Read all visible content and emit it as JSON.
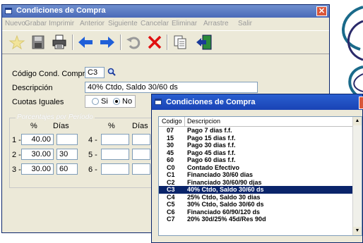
{
  "main_window": {
    "title": "Condiciones de Compra",
    "menu": [
      "Nuevo",
      "Grabar",
      "Imprimir",
      "Anterior",
      "Siguiente",
      "Cancelar",
      "Eliminar",
      "Arrastre",
      "Salir"
    ],
    "toolbar_icons": [
      "new-star-icon",
      "save-disk-icon",
      "print-icon",
      "back-arrow-icon",
      "forward-arrow-icon",
      "undo-icon",
      "delete-x-icon",
      "copy-icon",
      "exit-door-icon"
    ]
  },
  "form": {
    "codigo_label": "Código Cond. Compra",
    "codigo_value": "C3",
    "descripcion_label": "Descripción",
    "descripcion_value": "40% Ctdo, Saldo 30/60 ds",
    "cuotas_label": "Cuotas Iguales",
    "opt_si": "Si",
    "opt_no": "No",
    "cuotas_selected": "No",
    "group_title": "Porcentajes por Período",
    "col_pct": "%",
    "col_dias": "Días",
    "rows": [
      {
        "label": "1 -",
        "pct": "40.00",
        "dias": ""
      },
      {
        "label": "2 -",
        "pct": "30.00",
        "dias": "30"
      },
      {
        "label": "3 -",
        "pct": "30.00",
        "dias": "60"
      }
    ],
    "rows_right": [
      {
        "label": "4 -",
        "pct": "",
        "dias": ""
      },
      {
        "label": "5 -",
        "pct": "",
        "dias": ""
      },
      {
        "label": "6 -",
        "pct": "",
        "dias": ""
      }
    ]
  },
  "popup": {
    "title": "Condiciones de Compra",
    "headers": {
      "codigo": "Codigo",
      "descripcion": "Descripcion"
    },
    "items": [
      {
        "codigo": "07",
        "descripcion": "Pago 7 dias f.f."
      },
      {
        "codigo": "15",
        "descripcion": "Pago 15 dias f.f."
      },
      {
        "codigo": "30",
        "descripcion": "Pago 30 dias f.f."
      },
      {
        "codigo": "45",
        "descripcion": "Pago 45 dias f.f."
      },
      {
        "codigo": "60",
        "descripcion": "Pago 60 dias f.f."
      },
      {
        "codigo": "C0",
        "descripcion": "Contado Efectivo"
      },
      {
        "codigo": "C1",
        "descripcion": "Financiado 30/60 dias"
      },
      {
        "codigo": "C2",
        "descripcion": "Financiado 30/60/90 djas"
      },
      {
        "codigo": "C3",
        "descripcion": "40% Ctdo, Saldo 30/60 ds"
      },
      {
        "codigo": "C4",
        "descripcion": "25% Ctdo, Saldo 30 dias"
      },
      {
        "codigo": "C5",
        "descripcion": "30% Ctdo, Saldo 30/60 ds"
      },
      {
        "codigo": "C6",
        "descripcion": "Financiado 60/90/120 ds"
      },
      {
        "codigo": "C7",
        "descripcion": "20% 30d/25% 45d/Res 90d"
      }
    ],
    "selected_index": 8
  }
}
